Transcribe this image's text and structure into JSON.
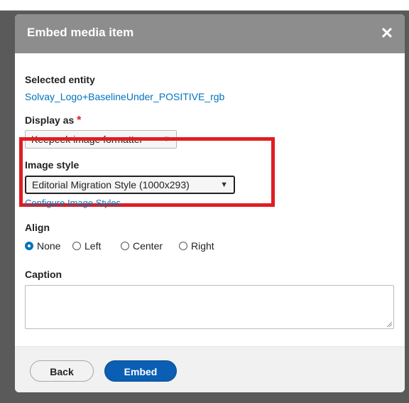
{
  "dialog": {
    "title": "Embed media item",
    "close_symbol": "✕"
  },
  "selected_entity": {
    "label": "Selected entity",
    "value": "Solvay_Logo+BaselineUnder_POSITIVE_rgb"
  },
  "display_as": {
    "label": "Display as",
    "required_marker": "*",
    "selected": "Keepeek image formatter"
  },
  "image_style": {
    "label": "Image style",
    "selected": "Editorial Migration Style (1000x293)",
    "configure_link": "Configure Image Styles",
    "highlight_color": "#e11d22"
  },
  "align": {
    "label": "Align",
    "options": [
      "None",
      "Left",
      "Center",
      "Right"
    ],
    "selected": "None"
  },
  "caption": {
    "label": "Caption",
    "value": ""
  },
  "footer": {
    "back_label": "Back",
    "embed_label": "Embed"
  },
  "colors": {
    "link": "#0074bd",
    "primary_button": "#0a5fb4",
    "titlebar": "#8d8d8d"
  }
}
